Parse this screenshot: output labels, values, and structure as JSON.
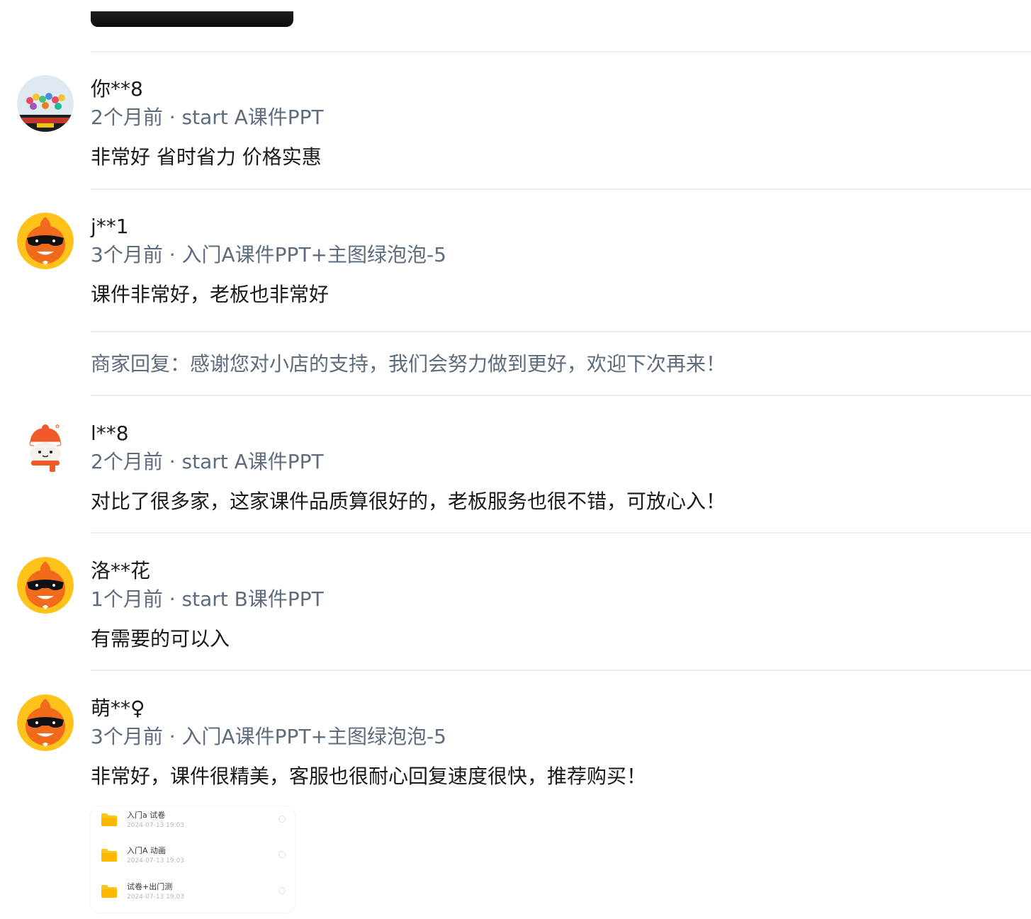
{
  "reviews": [
    {
      "username": "你**8",
      "meta": "2个月前 · start A课件PPT",
      "content": "非常好 省时省力 价格实惠"
    },
    {
      "username": "j**1",
      "meta": "3个月前 · 入门A课件PPT+主图绿泡泡-5",
      "content": "课件非常好，老板也非常好",
      "reply": "商家回复：感谢您对小店的支持，我们会努力做到更好，欢迎下次再来！"
    },
    {
      "username": "l**8",
      "meta": "2个月前 · start A课件PPT",
      "content": "对比了很多家，这家课件品质算很好的，老板服务也很不错，可放心入！"
    },
    {
      "username": "洛**花",
      "meta": "1个月前 · start B课件PPT",
      "content": "有需要的可以入"
    },
    {
      "username": "萌**♀",
      "meta": "3个月前 · 入门A课件PPT+主图绿泡泡-5",
      "content": "非常好，课件很精美，客服也很耐心回复速度很快，推荐购买！"
    }
  ],
  "attachment": {
    "files": [
      {
        "name": "入门a 试卷",
        "date": "2024-07-13 19:03",
        "icon": "folder-icon"
      },
      {
        "name": "入门A 动画",
        "date": "2024-07-13 19:03",
        "icon": "folder-icon"
      },
      {
        "name": "试卷+出门测",
        "date": "2024-07-13 19:03",
        "icon": "folder-icon"
      }
    ]
  },
  "colors": {
    "meta_text": "#5c6b7e",
    "main_text": "#1a1a1a",
    "divider": "#eeeeee",
    "mascot_orange": "#f26a1b",
    "avatar_yellow": "#ffc21a"
  }
}
